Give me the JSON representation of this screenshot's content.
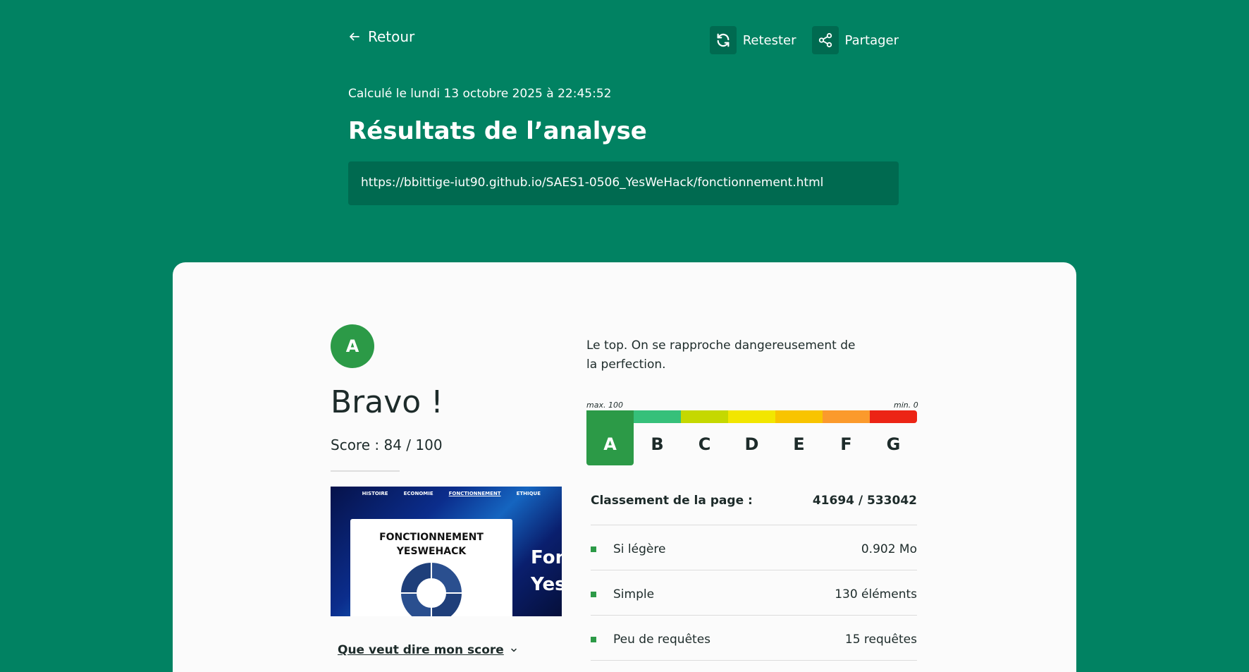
{
  "header": {
    "back_label": "Retour",
    "retest_label": "Retester",
    "share_label": "Partager",
    "calc_date": "Calculé le lundi 13 octobre 2025 à 22:45:52",
    "title": "Résultats de l’analyse",
    "url": "https://bbittige-iut90.github.io/SAES1-0506_YesWeHack/fonctionnement.html"
  },
  "result": {
    "grade": "A",
    "headline": "Bravo !",
    "score_text": "Score : 84 / 100",
    "score_link": "Que veut dire mon score",
    "description": "Le top. On se rapproche dangereusement de la perfection."
  },
  "thumbnail": {
    "nav": [
      "HISTOIRE",
      "ECONOMIE",
      "FONCTIONNEMENT",
      "ETHIQUE"
    ],
    "panel_title_1": "FONCTIONNEMENT",
    "panel_title_2": "YESWEHACK",
    "side_text_1": "Fonc",
    "side_text_2": "YesW"
  },
  "scale": {
    "max_label": "max. 100",
    "min_label": "min. 0",
    "letters": [
      "A",
      "B",
      "C",
      "D",
      "E",
      "F",
      "G"
    ],
    "colors": [
      "#2c9a47",
      "#36c07a",
      "#c5d800",
      "#f2e600",
      "#f8c400",
      "#fb9a2c",
      "#ec2415"
    ],
    "active": "A"
  },
  "ranking": {
    "label": "Classement de la page :",
    "value": "41694 / 533042"
  },
  "metrics": [
    {
      "label": "Si légère",
      "value": "0.902 Mo"
    },
    {
      "label": "Simple",
      "value": "130 éléments"
    },
    {
      "label": "Peu de requêtes",
      "value": "15 requêtes"
    }
  ],
  "colors": {
    "background": "#018262",
    "accent_dark": "#006a50",
    "grade_green": "#2c9a47"
  }
}
